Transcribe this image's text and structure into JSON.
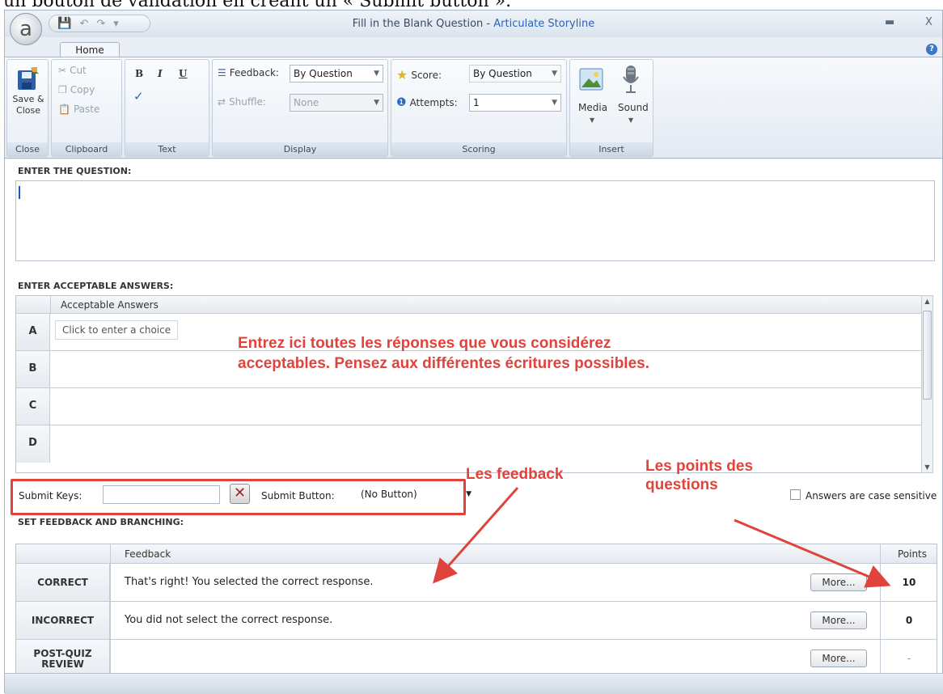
{
  "caption": "un bouton de validation en créant un « Submit button ».",
  "window": {
    "title_prefix": "Fill in the Blank Question - ",
    "title_brand": "Articulate Storyline",
    "logo_letter": "a",
    "minimize": "▬",
    "close": "X",
    "help": "?"
  },
  "tabs": [
    "Home"
  ],
  "ribbon": {
    "close_group": {
      "save_close": "Save & Close",
      "label": "Close"
    },
    "clipboard": {
      "cut": "Cut",
      "copy": "Copy",
      "paste": "Paste",
      "label": "Clipboard"
    },
    "text": {
      "bold": "B",
      "italic": "I",
      "underline": "U",
      "label": "Text"
    },
    "display": {
      "feedback_label": "Feedback:",
      "feedback_value": "By Question",
      "shuffle_label": "Shuffle:",
      "shuffle_value": "None",
      "label": "Display"
    },
    "scoring": {
      "score_label": "Score:",
      "score_value": "By Question",
      "attempts_label": "Attempts:",
      "attempts_value": "1",
      "label": "Scoring"
    },
    "insert": {
      "media": "Media",
      "sound": "Sound",
      "label": "Insert"
    }
  },
  "question": {
    "heading": "ENTER THE QUESTION:",
    "value": ""
  },
  "answers": {
    "heading": "ENTER ACCEPTABLE ANSWERS:",
    "column": "Acceptable Answers",
    "rows": [
      {
        "letter": "A",
        "value": "Click to enter a choice"
      },
      {
        "letter": "B",
        "value": ""
      },
      {
        "letter": "C",
        "value": ""
      },
      {
        "letter": "D",
        "value": ""
      }
    ]
  },
  "submit": {
    "keys_label": "Submit Keys:",
    "keys_value": "",
    "button_label": "Submit Button:",
    "button_value": "(No Button)",
    "case_sensitive_label": "Answers are case sensitive",
    "case_sensitive": false
  },
  "feedback": {
    "heading": "SET FEEDBACK AND BRANCHING:",
    "col_feedback": "Feedback",
    "col_points": "Points",
    "more_label": "More...",
    "rows": [
      {
        "name": "CORRECT",
        "text": "That's right!  You selected the correct response.",
        "points": "10"
      },
      {
        "name": "INCORRECT",
        "text": "You did not select the correct response.",
        "points": "0"
      },
      {
        "name": "POST-QUIZ REVIEW",
        "text": "",
        "points": "-"
      }
    ]
  },
  "annotations": {
    "answers_note_1": "Entrez ici toutes les réponses que vous considérez",
    "answers_note_2": "acceptables. Pensez aux différentes écritures possibles.",
    "feedback_note": "Les feedback",
    "points_note_1": "Les points des",
    "points_note_2": "questions",
    "color": "#e0433b"
  }
}
